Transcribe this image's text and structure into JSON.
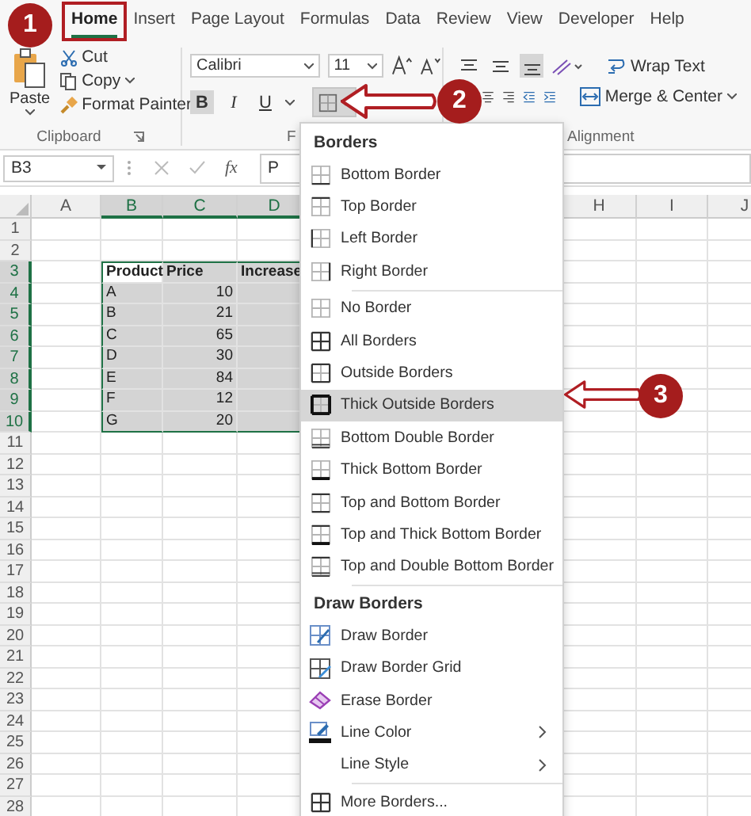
{
  "tabs": [
    {
      "label": "Home",
      "selected": true
    },
    {
      "label": "Insert",
      "selected": false
    },
    {
      "label": "Page Layout",
      "selected": false
    },
    {
      "label": "Formulas",
      "selected": false
    },
    {
      "label": "Data",
      "selected": false
    },
    {
      "label": "Review",
      "selected": false
    },
    {
      "label": "View",
      "selected": false
    },
    {
      "label": "Developer",
      "selected": false
    },
    {
      "label": "Help",
      "selected": false
    }
  ],
  "clipboard": {
    "paste": "Paste",
    "cut": "Cut",
    "copy": "Copy",
    "format_painter": "Format Painter",
    "label": "Clipboard"
  },
  "font": {
    "name": "Calibri",
    "size": "11",
    "label": "F",
    "buttons": [
      {
        "label": "B",
        "pressed": true
      },
      {
        "label": "I",
        "pressed": false
      },
      {
        "label": "U",
        "pressed": false
      }
    ],
    "borders_pressed": true
  },
  "alignment": {
    "wrap": "Wrap Text",
    "merge": "Merge & Center",
    "label": "Alignment",
    "vertical": [
      {
        "kind": "top",
        "pressed": false
      },
      {
        "kind": "middle",
        "pressed": false
      },
      {
        "kind": "bottom",
        "pressed": true
      }
    ]
  },
  "formula_bar": {
    "name_box": "B3",
    "fx": "fx",
    "value": "P"
  },
  "sheet": {
    "columns": [
      {
        "label": "A",
        "selected": false
      },
      {
        "label": "B",
        "selected": true
      },
      {
        "label": "C",
        "selected": true
      },
      {
        "label": "D",
        "selected": true
      },
      {
        "label": "H",
        "selected": false
      },
      {
        "label": "I",
        "selected": false
      },
      {
        "label": "J",
        "selected": false
      }
    ],
    "rows": [
      {
        "label": "1",
        "selected": false
      },
      {
        "label": "2",
        "selected": false
      },
      {
        "label": "3",
        "selected": true
      },
      {
        "label": "4",
        "selected": true
      },
      {
        "label": "5",
        "selected": true
      },
      {
        "label": "6",
        "selected": true
      },
      {
        "label": "7",
        "selected": true
      },
      {
        "label": "8",
        "selected": true
      },
      {
        "label": "9",
        "selected": true
      },
      {
        "label": "10",
        "selected": true
      },
      {
        "label": "11",
        "selected": false
      },
      {
        "label": "12",
        "selected": false
      },
      {
        "label": "13",
        "selected": false
      },
      {
        "label": "14",
        "selected": false
      },
      {
        "label": "15",
        "selected": false
      },
      {
        "label": "16",
        "selected": false
      },
      {
        "label": "17",
        "selected": false
      },
      {
        "label": "18",
        "selected": false
      },
      {
        "label": "19",
        "selected": false
      },
      {
        "label": "20",
        "selected": false
      },
      {
        "label": "21",
        "selected": false
      },
      {
        "label": "22",
        "selected": false
      },
      {
        "label": "23",
        "selected": false
      },
      {
        "label": "24",
        "selected": false
      },
      {
        "label": "25",
        "selected": false
      },
      {
        "label": "26",
        "selected": false
      },
      {
        "label": "27",
        "selected": false
      },
      {
        "label": "28",
        "selected": false
      }
    ],
    "table": {
      "header": [
        "Product",
        "Price",
        "Increase"
      ],
      "rows": [
        [
          "A",
          "10"
        ],
        [
          "B",
          "21"
        ],
        [
          "C",
          "65"
        ],
        [
          "D",
          "30"
        ],
        [
          "E",
          "84"
        ],
        [
          "F",
          "12"
        ],
        [
          "G",
          "20"
        ]
      ]
    }
  },
  "menu": {
    "sections": [
      {
        "heading": "Borders",
        "items": [
          {
            "label": "Bottom Border",
            "kind": "bottom",
            "selected": false
          },
          {
            "label": "Top Border",
            "kind": "top",
            "selected": false
          },
          {
            "label": "Left Border",
            "kind": "left",
            "selected": false
          },
          {
            "label": "Right Border",
            "kind": "right",
            "selected": false
          }
        ]
      },
      {
        "items": [
          {
            "label": "No Border",
            "kind": "none",
            "selected": false
          },
          {
            "label": "All Borders",
            "kind": "all",
            "selected": false
          },
          {
            "label": "Outside Borders",
            "kind": "outside",
            "selected": false
          },
          {
            "label": "Thick Outside Borders",
            "kind": "thick-outside",
            "selected": true
          },
          {
            "label": "Bottom Double Border",
            "kind": "bottom-double",
            "selected": false
          },
          {
            "label": "Thick Bottom Border",
            "kind": "thick-bottom",
            "selected": false
          },
          {
            "label": "Top and Bottom Border",
            "kind": "top-bottom",
            "selected": false
          },
          {
            "label": "Top and Thick Bottom Border",
            "kind": "top-thick-bottom",
            "selected": false
          },
          {
            "label": "Top and Double Bottom Border",
            "kind": "top-double-bottom",
            "selected": false
          }
        ]
      },
      {
        "heading": "Draw Borders",
        "items": [
          {
            "label": "Draw Border",
            "kind": "draw",
            "selected": false
          },
          {
            "label": "Draw Border Grid",
            "kind": "draw-grid",
            "selected": false
          },
          {
            "label": "Erase Border",
            "kind": "erase",
            "selected": false
          },
          {
            "label": "Line Color",
            "kind": "line-color",
            "selected": false,
            "submenu": true
          },
          {
            "label": "Line Style",
            "kind": "line-style",
            "selected": false,
            "submenu": true
          }
        ]
      },
      {
        "items": [
          {
            "label": "More Borders...",
            "kind": "more",
            "selected": false
          }
        ]
      }
    ]
  },
  "callouts": [
    "1",
    "2",
    "3"
  ]
}
